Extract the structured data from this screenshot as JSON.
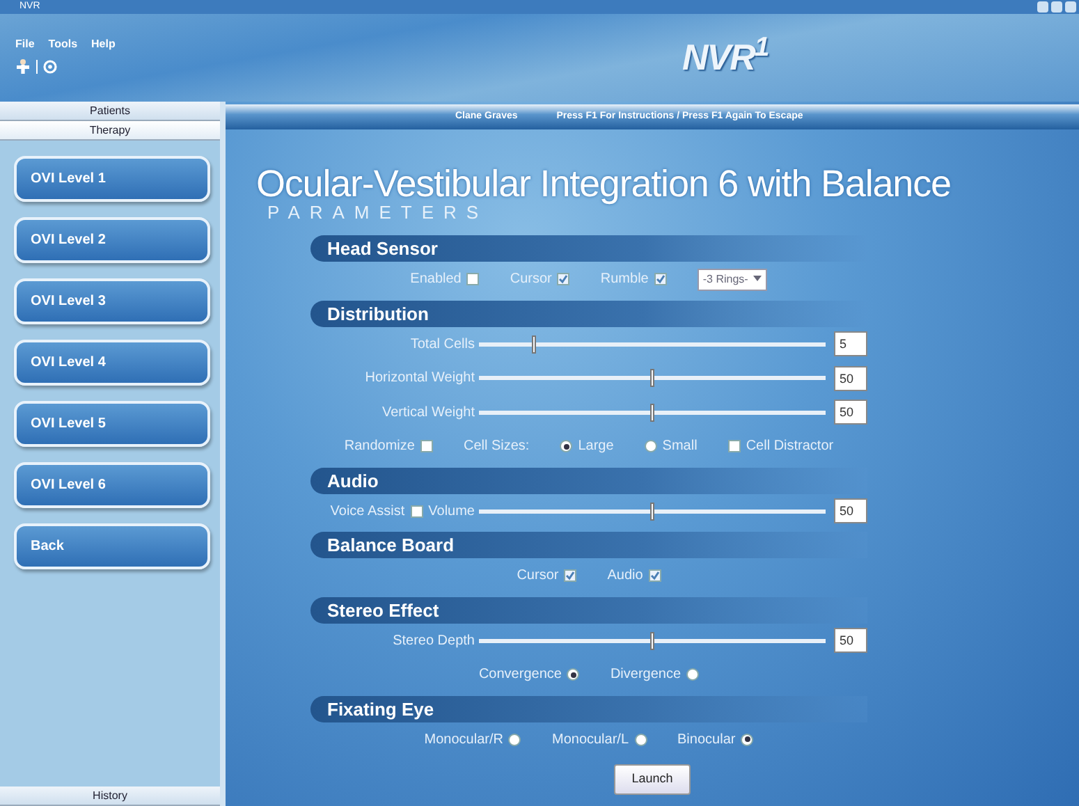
{
  "window": {
    "title": "NVR"
  },
  "menu": [
    "File",
    "Tools",
    "Help"
  ],
  "logo": "NVR$^{1}$",
  "sidebar": {
    "tabs": [
      {
        "label": "Patients",
        "selected": false
      },
      {
        "label": "Therapy",
        "selected": true
      }
    ],
    "buttons": [
      "OVI Level 1",
      "OVI Level 2",
      "OVI Level 3",
      "OVI Level 4",
      "OVI Level 5",
      "OVI Level 6",
      "Back"
    ],
    "bottom_tab": "History"
  },
  "top_bar": {
    "patient": "Clane Graves",
    "hint": "Press F1 For Instructions / Press F1 Again To Escape"
  },
  "title": "Ocular-Vestibular Integration 6 with Balance",
  "subtitle": "PARAMETERS",
  "sections": [
    {
      "title": "Head Sensor",
      "rows": [
        [
          {
            "kind": "check",
            "label": "Enabled",
            "checked": false
          },
          {
            "kind": "check",
            "label": "Cursor",
            "checked": true
          },
          {
            "kind": "check",
            "label": "Rumble",
            "checked": true
          },
          {
            "kind": "select",
            "value": "-3 Rings-"
          }
        ]
      ]
    },
    {
      "title": "Distribution",
      "rows": [
        [
          {
            "kind": "slider",
            "label": "Total Cells",
            "level": 0.16,
            "value": "5"
          }
        ],
        [
          {
            "kind": "slider",
            "label": "Horizontal Weight",
            "level": 0.5,
            "value": "50"
          }
        ],
        [
          {
            "kind": "slider",
            "label": "Vertical Weight",
            "level": 0.5,
            "value": "50"
          }
        ],
        [
          {
            "kind": "check",
            "label": "Randomize",
            "checked": false
          },
          {
            "kind": "text",
            "label": "Cell Sizes:"
          },
          {
            "kind": "radio_before",
            "label": "Large",
            "selected": true
          },
          {
            "kind": "radio_before",
            "label": "Small",
            "selected": false
          },
          {
            "kind": "check_before",
            "label": "Cell Distractor",
            "checked": false
          }
        ]
      ]
    },
    {
      "title": "Audio",
      "rows": [
        [
          {
            "kind": "check",
            "label": "Voice Assist",
            "checked": false
          },
          {
            "kind": "slider",
            "label": "Volume",
            "level": 0.5,
            "value": "50"
          }
        ]
      ]
    },
    {
      "title": "Balance Board",
      "rows": [
        [
          {
            "kind": "check",
            "label": "Cursor",
            "checked": true
          },
          {
            "kind": "check",
            "label": "Audio",
            "checked": true
          }
        ]
      ]
    },
    {
      "title": "Stereo Effect",
      "rows": [
        [
          {
            "kind": "slider",
            "label": "Stereo Depth",
            "level": 0.5,
            "value": "50"
          }
        ],
        [
          {
            "kind": "radio",
            "label": "Convergence",
            "selected": true
          },
          {
            "kind": "radio",
            "label": "Divergence",
            "selected": false
          }
        ]
      ]
    },
    {
      "title": "Fixating Eye",
      "rows": [
        [
          {
            "kind": "radio",
            "label": "Monocular/R",
            "selected": false
          },
          {
            "kind": "radio",
            "label": "Monocular/L",
            "selected": false
          },
          {
            "kind": "radio",
            "label": "Binocular",
            "selected": true
          }
        ]
      ]
    }
  ],
  "launch_button": "Launch"
}
